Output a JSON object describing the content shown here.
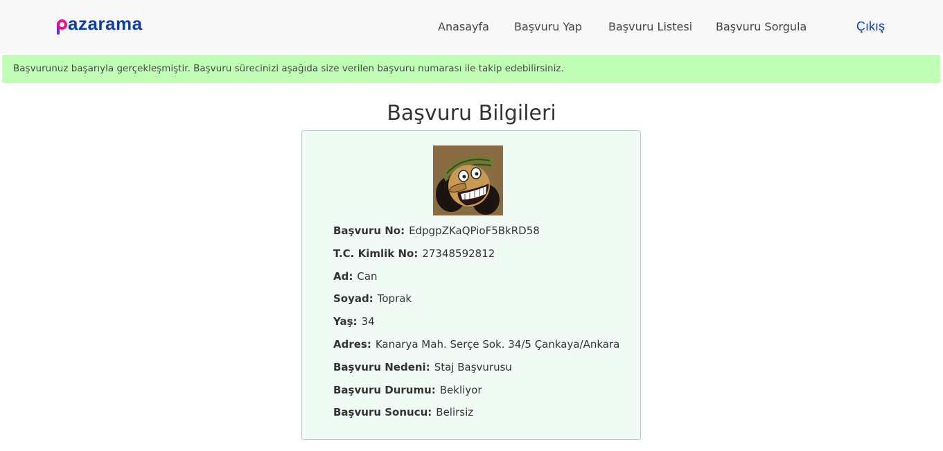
{
  "brand": {
    "logo_text": "azarama",
    "logo_letter": "p"
  },
  "nav": {
    "links": [
      "Anasayfa",
      "Başvuru Yap",
      "Başvuru Listesi",
      "Başvuru Sorgula"
    ],
    "logout": "Çıkış"
  },
  "alert": {
    "message": "Başvurunuz başarıyla gerçekleşmiştir. Başvuru sürecinizi aşağıda size verilen başvuru numarası ile takip edebilirsiniz."
  },
  "page": {
    "title": "Başvuru Bilgileri"
  },
  "details": [
    {
      "label": "Başvuru No:",
      "value": "EdpgpZKaQPioF5BkRD58"
    },
    {
      "label": "T.C. Kimlik No:",
      "value": "27348592812"
    },
    {
      "label": "Ad:",
      "value": "Can"
    },
    {
      "label": "Soyad:",
      "value": "Toprak"
    },
    {
      "label": "Yaş:",
      "value": "34"
    },
    {
      "label": "Adres:",
      "value": "Kanarya Mah. Serçe Sok. 34/5 Çankaya/Ankara"
    },
    {
      "label": "Başvuru Nedeni:",
      "value": "Staj Başvurusu"
    },
    {
      "label": "Başvuru Durumu:",
      "value": "Bekliyor"
    },
    {
      "label": "Başvuru Sonucu:",
      "value": "Belirsiz"
    }
  ],
  "colors": {
    "alert_bg": "#c2ffb6",
    "card_bg": "#f1fbf6",
    "logout": "#0a3fc9",
    "logo_pink": "#e5138b",
    "logo_blue": "#0f3ea8"
  }
}
